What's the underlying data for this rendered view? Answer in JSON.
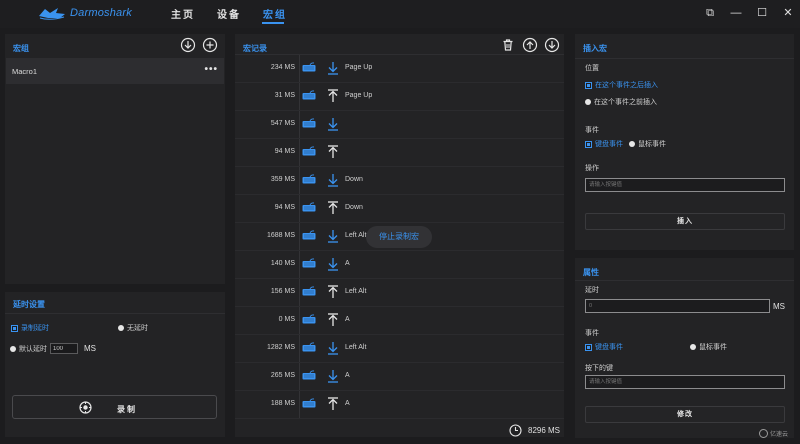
{
  "app": {
    "brand": "Darmoshark"
  },
  "nav": {
    "tabs": [
      {
        "label": "主页"
      },
      {
        "label": "设备"
      },
      {
        "label": "宏组"
      }
    ]
  },
  "window": {
    "restore": "⧉",
    "minimize": "—",
    "maximize": "☐",
    "close": "✕"
  },
  "macro_group": {
    "title": "宏组",
    "items": [
      {
        "name": "Macro1",
        "more": "•••"
      }
    ]
  },
  "delay_settings": {
    "title": "延时设置",
    "record_delay": "录制延时",
    "no_delay": "无延时",
    "default_delay": "默认延时",
    "default_delay_value": "100",
    "ms": "MS",
    "record_button": "录制"
  },
  "records": {
    "title": "宏记录",
    "stop_label": "停止录制宏",
    "total": "8296 MS",
    "rows": [
      {
        "time": "234 MS",
        "dir": "down",
        "key": "Page Up"
      },
      {
        "time": "31 MS",
        "dir": "up",
        "key": "Page Up"
      },
      {
        "time": "547 MS",
        "dir": "down",
        "key": ""
      },
      {
        "time": "94 MS",
        "dir": "up",
        "key": ""
      },
      {
        "time": "359 MS",
        "dir": "down",
        "key": "Down"
      },
      {
        "time": "94 MS",
        "dir": "up",
        "key": "Down"
      },
      {
        "time": "1688 MS",
        "dir": "down",
        "key": "Left Alt"
      },
      {
        "time": "140 MS",
        "dir": "down",
        "key": "A"
      },
      {
        "time": "156 MS",
        "dir": "up",
        "key": "Left Alt"
      },
      {
        "time": "0 MS",
        "dir": "up",
        "key": "A"
      },
      {
        "time": "1282 MS",
        "dir": "down",
        "key": "Left Alt"
      },
      {
        "time": "265 MS",
        "dir": "down",
        "key": "A"
      },
      {
        "time": "188 MS",
        "dir": "up",
        "key": "A"
      }
    ]
  },
  "insert_macro": {
    "title": "插入宏",
    "position_label": "位置",
    "after_event": "在这个事件之后插入",
    "before_event": "在这个事件之前插入",
    "event_label": "事件",
    "keyboard_event": "键盘事件",
    "mouse_event": "鼠标事件",
    "operation_label": "操作",
    "operation_placeholder": "请输入按键值",
    "insert_button": "插入"
  },
  "properties": {
    "title": "属性",
    "delay_label": "延时",
    "delay_value": "0",
    "ms": "MS",
    "event_label": "事件",
    "keyboard_event": "键盘事件",
    "mouse_event": "鼠标事件",
    "key_label": "按下的键",
    "key_placeholder": "请输入按键值",
    "modify_button": "修改"
  },
  "watermark": {
    "text": "亿速云"
  },
  "colors": {
    "accent": "#3a93f0",
    "panel": "#232325",
    "background": "#1c1c1e"
  }
}
